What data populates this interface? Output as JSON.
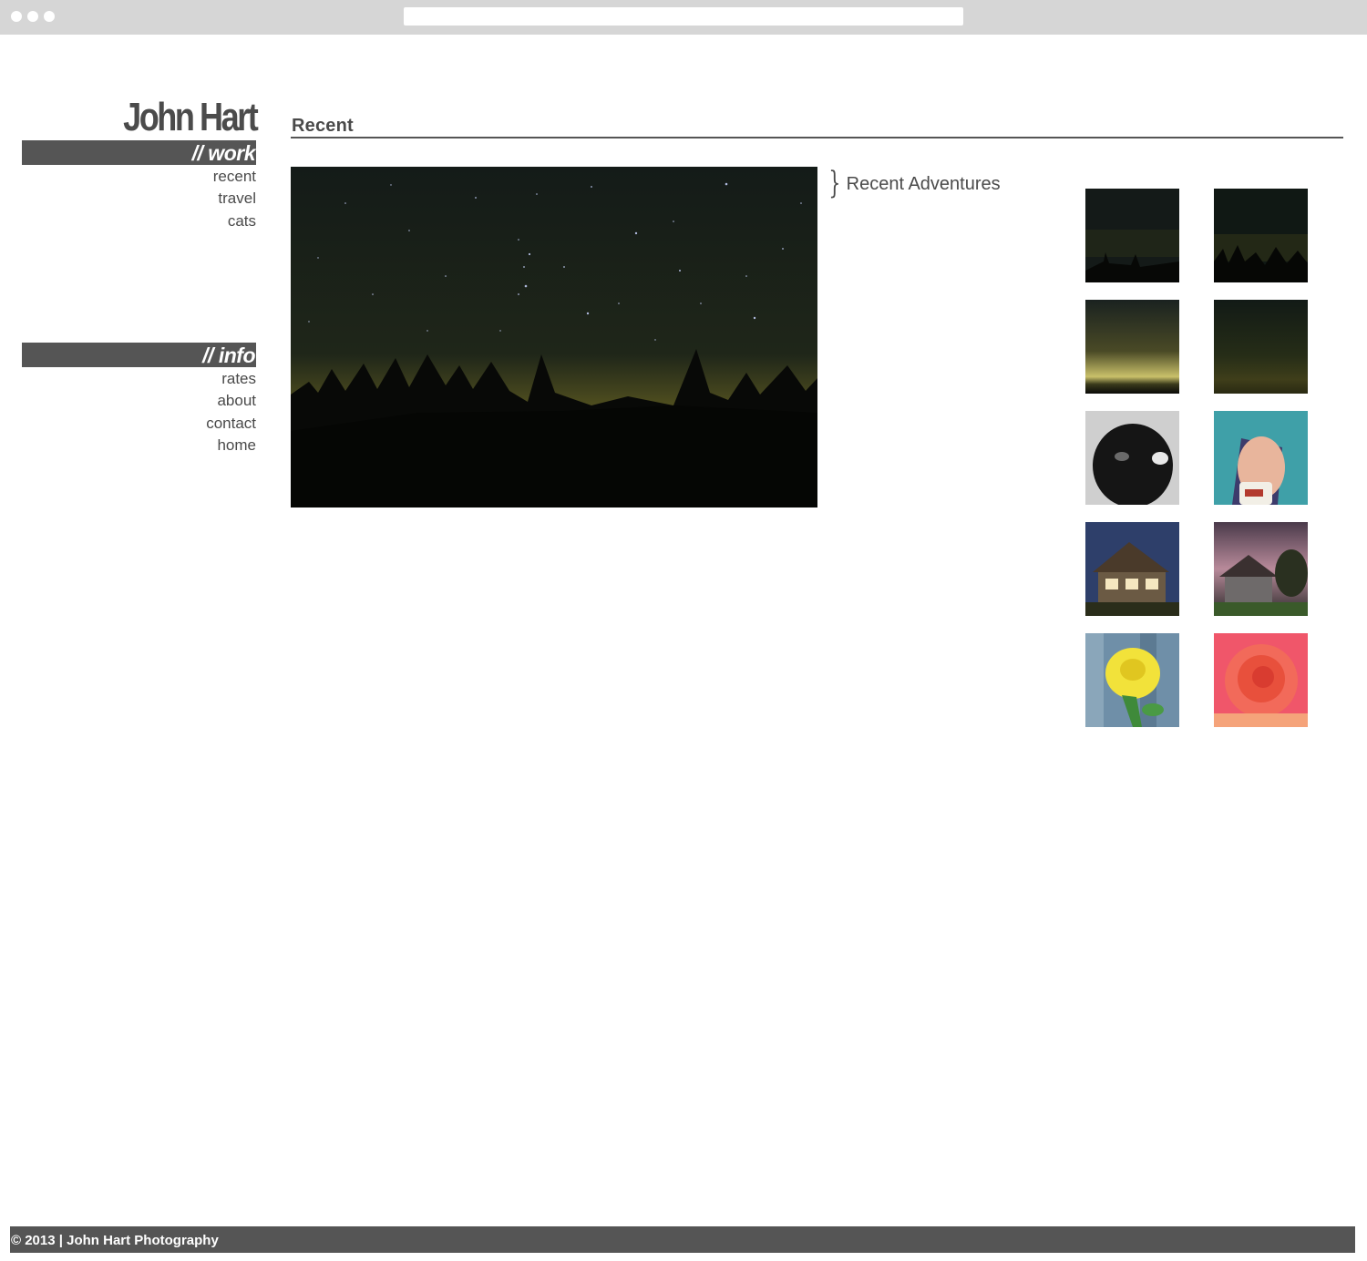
{
  "site": {
    "title": "John Hart"
  },
  "nav": {
    "work_heading": "// work",
    "work_items": [
      "recent",
      "travel",
      "cats"
    ],
    "info_heading": "// info",
    "info_items": [
      "rates",
      "about",
      "contact",
      "home"
    ]
  },
  "main": {
    "section_title": "Recent",
    "gallery_caption": "Recent Adventures",
    "featured_photo": "night-sky-stars-tree-silhouettes",
    "thumbnails": [
      "night-sky-trees-1",
      "night-sky-trees-2",
      "dusk-sky-glow",
      "night-sky-dark",
      "woman-black-hair-bw",
      "woman-blue-hair-mug",
      "house-porch-night",
      "house-garden-dusk",
      "yellow-rose",
      "red-rose"
    ]
  },
  "footer": {
    "text": "© 2013 | John Hart Photography"
  },
  "colors": {
    "nav_bar": "#555555",
    "text": "#4a4a4a",
    "chrome": "#d6d6d6"
  }
}
